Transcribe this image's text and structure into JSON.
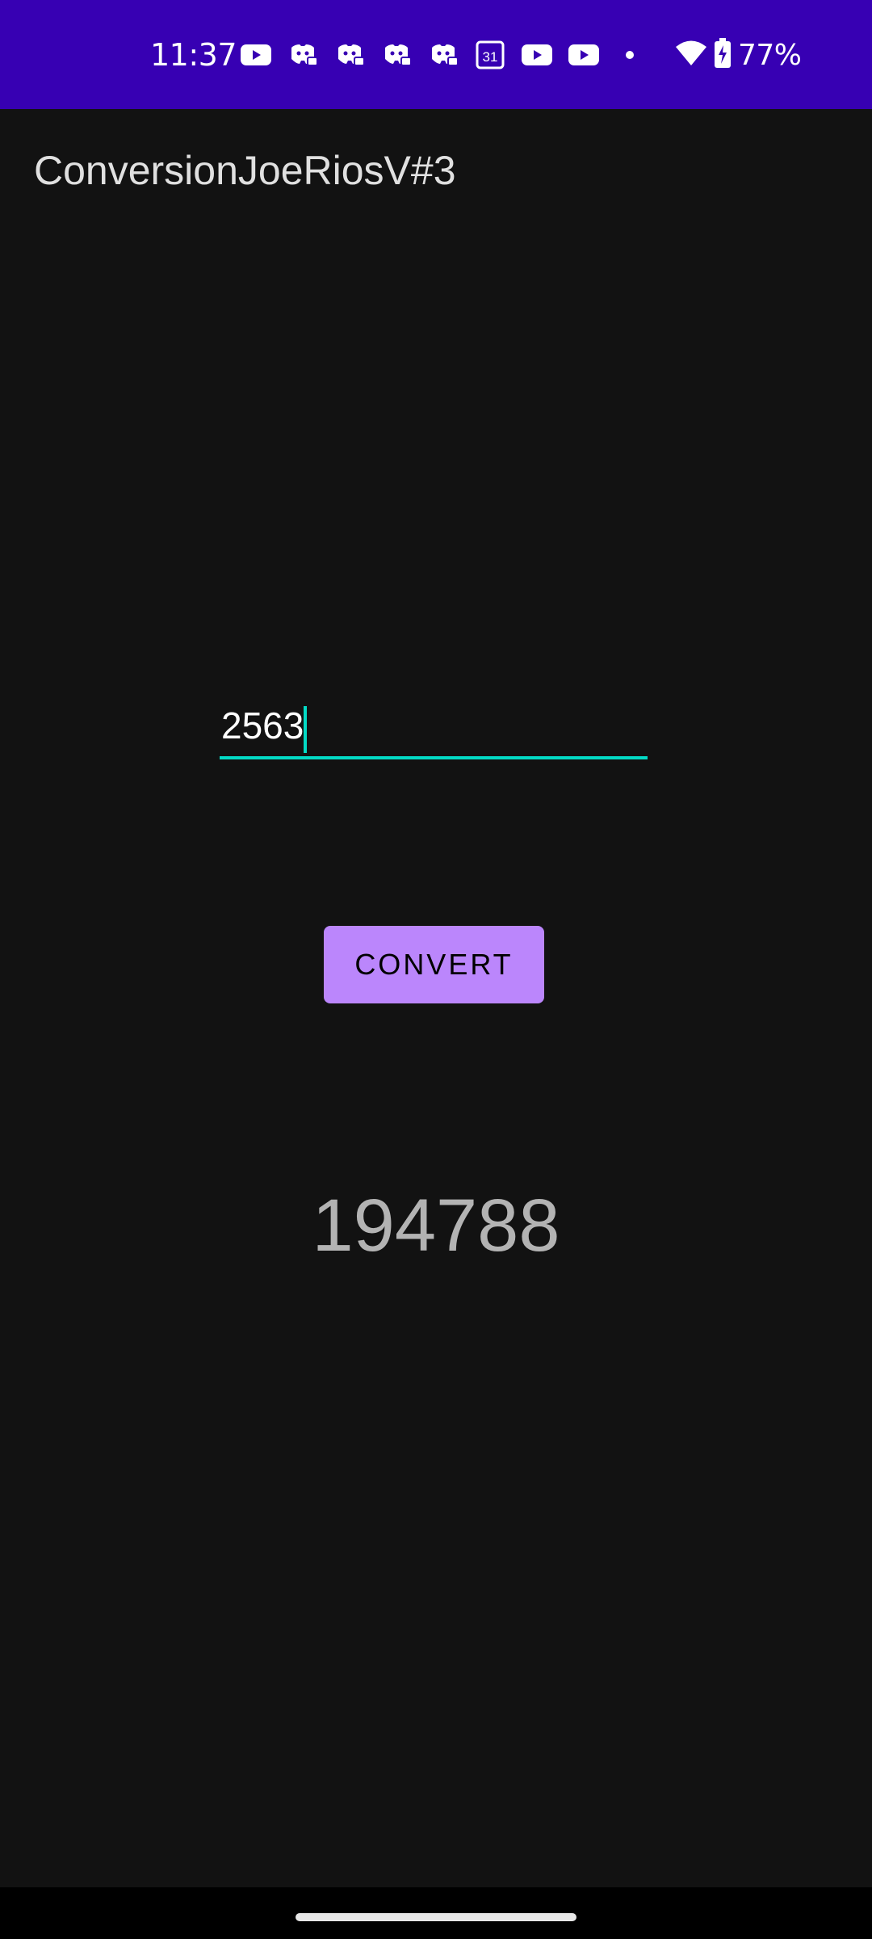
{
  "status_bar": {
    "time": "11:37",
    "battery": "77%",
    "background": "#3700b3",
    "notification_icons": [
      "youtube-icon",
      "discord-icon",
      "discord-icon",
      "discord-icon",
      "discord-icon",
      "calendar-icon",
      "youtube-icon",
      "youtube-icon"
    ],
    "calendar_day": "31"
  },
  "app_bar": {
    "title": "ConversionJoeRiosV#3"
  },
  "input": {
    "value": "2563",
    "accent_color": "#03dac5"
  },
  "button": {
    "label": "CONVERT",
    "color": "#bb86fc"
  },
  "result": {
    "value": "194788"
  }
}
